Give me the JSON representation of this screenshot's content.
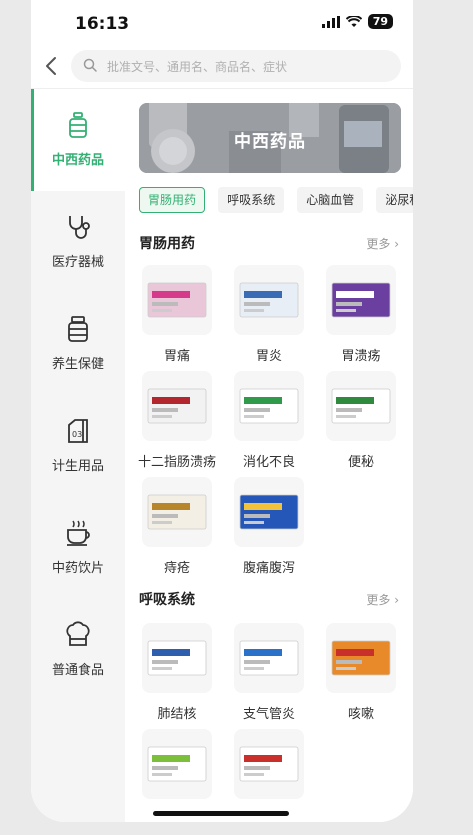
{
  "status_bar": {
    "time": "16:13",
    "battery": "79"
  },
  "search": {
    "placeholder": "批准文号、通用名、商品名、症状"
  },
  "sidebar": {
    "items": [
      {
        "label": "中西药品",
        "icon": "medicine-bottle-icon",
        "active": true
      },
      {
        "label": "医疗器械",
        "icon": "stethoscope-icon"
      },
      {
        "label": "养生保健",
        "icon": "supplement-jar-icon"
      },
      {
        "label": "计生用品",
        "icon": "contraceptive-box-icon"
      },
      {
        "label": "中药饮片",
        "icon": "tea-cup-icon"
      },
      {
        "label": "普通食品",
        "icon": "bread-icon"
      }
    ]
  },
  "banner": {
    "title": "中西药品"
  },
  "chips": [
    "胃肠用药",
    "呼吸系统",
    "心脑血管",
    "泌尿科系"
  ],
  "sections": [
    {
      "title": "胃肠用药",
      "more": "更多",
      "products": [
        {
          "name": "胃痛",
          "box": "#e9c7d8",
          "accent": "#d63a8a"
        },
        {
          "name": "胃炎",
          "box": "#e8eef6",
          "accent": "#3a6bb5"
        },
        {
          "name": "胃溃疡",
          "box": "#6b3fa0",
          "accent": "#ffffff"
        },
        {
          "name": "十二指肠溃疡",
          "box": "#f2f2f2",
          "accent": "#b3262e"
        },
        {
          "name": "消化不良",
          "box": "#ffffff",
          "accent": "#2e9a4a"
        },
        {
          "name": "便秘",
          "box": "#ffffff",
          "accent": "#2f8a3e"
        },
        {
          "name": "痔疮",
          "box": "#f4efe4",
          "accent": "#b8862a"
        },
        {
          "name": "腹痛腹泻",
          "box": "#2457b8",
          "accent": "#f2c23a"
        }
      ]
    },
    {
      "title": "呼吸系统",
      "more": "更多",
      "products": [
        {
          "name": "肺结核",
          "box": "#ffffff",
          "accent": "#2d5fae"
        },
        {
          "name": "支气管炎",
          "box": "#ffffff",
          "accent": "#2a72c9"
        },
        {
          "name": "咳嗽",
          "box": "#e88a2a",
          "accent": "#c9302c"
        },
        {
          "name": "",
          "box": "#ffffff",
          "accent": "#7cbf3a"
        },
        {
          "name": "",
          "box": "#ffffff",
          "accent": "#c9302c"
        }
      ]
    }
  ],
  "colors": {
    "accent": "#33b073"
  }
}
